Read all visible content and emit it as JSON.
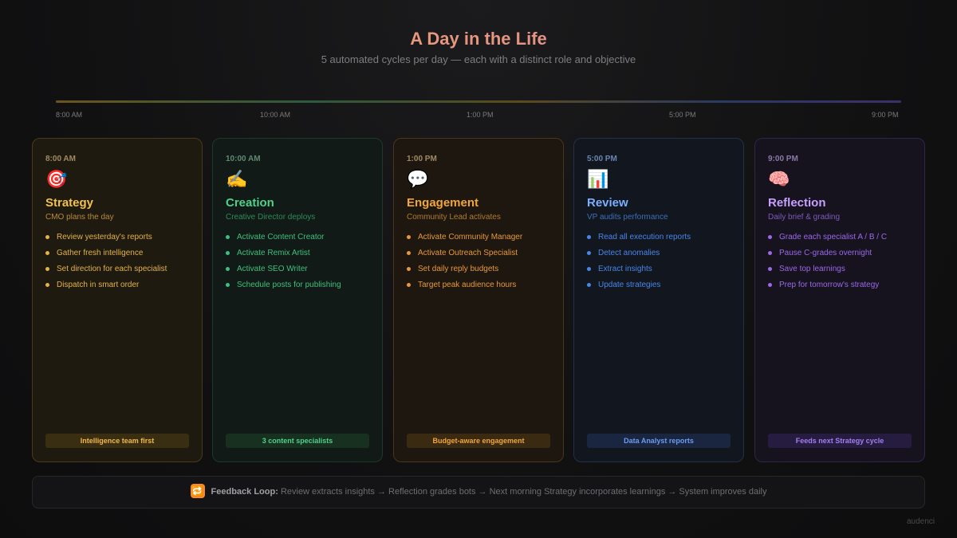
{
  "header": {
    "title": "A Day in the Life",
    "subtitle": "5 automated cycles per day — each with a distinct role and objective"
  },
  "timeline": [
    "8:00 AM",
    "10:00 AM",
    "1:00 PM",
    "5:00 PM",
    "9:00 PM"
  ],
  "cards": [
    {
      "time": "8:00 AM",
      "icon": "target-icon",
      "glyph": "🎯",
      "name": "Strategy",
      "role": "CMO plans the day",
      "items": [
        "Review yesterday's reports",
        "Gather fresh intelligence",
        "Set direction for each specialist",
        "Dispatch in smart order"
      ],
      "badge": "Intelligence team first",
      "colors": {
        "accent": "#f2c14e",
        "role": "#b88a3c",
        "item": "#e3b24a",
        "border": "#4a3a1a",
        "bg": "#1e1a10",
        "badge_bg": "#3a2e12",
        "badge_text": "#f2b84a",
        "time": "#a08a64"
      }
    },
    {
      "time": "10:00 AM",
      "icon": "writing-hand-icon",
      "glyph": "✍️",
      "name": "Creation",
      "role": "Creative Director deploys",
      "items": [
        "Activate Content Creator",
        "Activate Remix Artist",
        "Activate SEO Writer",
        "Schedule posts for publishing"
      ],
      "badge": "3 content specialists",
      "colors": {
        "accent": "#4fd18b",
        "role": "#2e8a5c",
        "item": "#3fbf7f",
        "border": "#1c3a2a",
        "bg": "#111a16",
        "badge_bg": "#17301f",
        "badge_text": "#4fd18b",
        "time": "#5f8a72"
      }
    },
    {
      "time": "1:00 PM",
      "icon": "speech-bubble-icon",
      "glyph": "💬",
      "name": "Engagement",
      "role": "Community Lead activates",
      "items": [
        "Activate Community Manager",
        "Activate Outreach Specialist",
        "Set daily reply budgets",
        "Target peak audience hours"
      ],
      "badge": "Budget-aware engagement",
      "colors": {
        "accent": "#f2a63a",
        "role": "#b07a30",
        "item": "#e8983a",
        "border": "#4a361a",
        "bg": "#1d1710",
        "badge_bg": "#3a2a12",
        "badge_text": "#f2a63a",
        "time": "#a08a64"
      }
    },
    {
      "time": "5:00 PM",
      "icon": "bar-chart-icon",
      "glyph": "📊",
      "name": "Review",
      "role": "VP audits performance",
      "items": [
        "Read all execution reports",
        "Detect anomalies",
        "Extract insights",
        "Update strategies"
      ],
      "badge": "Data Analyst reports",
      "colors": {
        "accent": "#7ab0ff",
        "role": "#3e6fb8",
        "item": "#4a86e8",
        "border": "#22304a",
        "bg": "#12161e",
        "badge_bg": "#1a2640",
        "badge_text": "#6a9cf0",
        "time": "#6a86b0"
      }
    },
    {
      "time": "9:00 PM",
      "icon": "brain-icon",
      "glyph": "🧠",
      "name": "Reflection",
      "role": "Daily brief & grading",
      "items": [
        "Grade each specialist A / B / C",
        "Pause C-grades overnight",
        "Save top learnings",
        "Prep for tomorrow's strategy"
      ],
      "badge": "Feeds next Strategy cycle",
      "colors": {
        "accent": "#c7a0ff",
        "role": "#7a5cb8",
        "item": "#9a6ae8",
        "border": "#30264a",
        "bg": "#16121e",
        "badge_bg": "#261c40",
        "badge_text": "#a57ef0",
        "time": "#8a7aa8"
      }
    }
  ],
  "feedback": {
    "icon": "repeat-icon",
    "glyph": "🔁",
    "label": "Feedback Loop:",
    "text": "Review extracts insights → Reflection grades bots → Next morning Strategy incorporates learnings → System improves daily"
  },
  "brand": "audenci"
}
